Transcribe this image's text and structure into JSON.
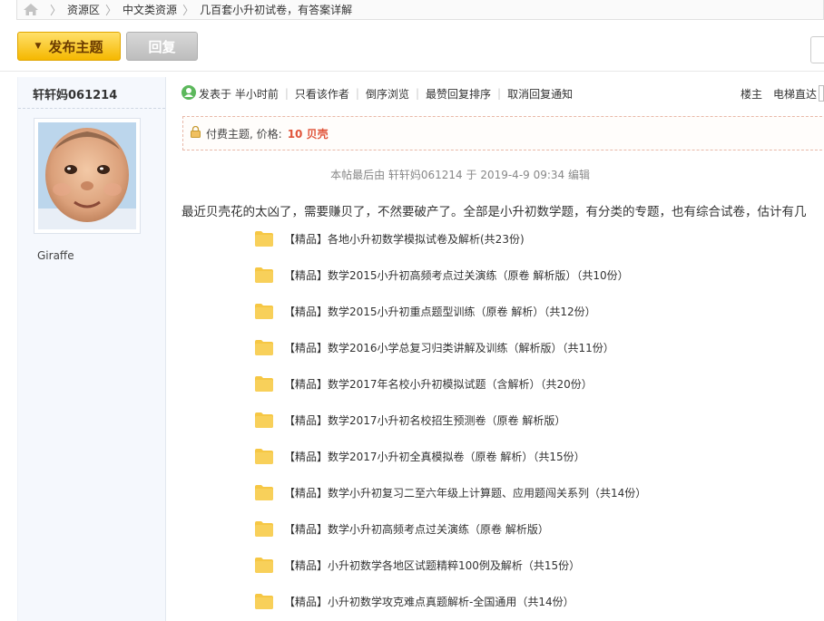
{
  "breadcrumb": {
    "items": [
      "资源区",
      "中文类资源",
      "几百套小升初试卷，有答案详解"
    ]
  },
  "actions": {
    "post_label": "发布主题",
    "reply_label": "回复"
  },
  "author": {
    "name": "轩轩妈061214",
    "group": "Giraffe"
  },
  "meta": {
    "posted": "发表于 半小时前",
    "links": [
      "只看该作者",
      "倒序浏览",
      "最赞回复排序",
      "取消回复通知"
    ],
    "floor": "楼主",
    "jump": "电梯直达"
  },
  "paid": {
    "label": "付费主题, 价格:",
    "price": "10 贝壳"
  },
  "edit_note": "本帖最后由 轩轩妈061214 于 2019-4-9 09:34 编辑",
  "intro": "最近贝壳花的太凶了，需要赚贝了，不然要破产了。全部是小升初数学题，有分类的专题，也有综合试卷，估计有几",
  "folders": [
    "【精品】各地小升初数学模拟试卷及解析(共23份)",
    "【精品】数学2015小升初高频考点过关演练（原卷 解析版）（共10份）",
    "【精品】数学2015小升初重点题型训练（原卷 解析）（共12份）",
    "【精品】数学2016小学总复习归类讲解及训练（解析版）（共11份）",
    "【精品】数学2017年名校小升初模拟试题（含解析）（共20份）",
    "【精品】数学2017小升初名校招生预测卷（原卷 解析版）",
    "【精品】数学2017小升初全真模拟卷（原卷 解析）（共15份）",
    "【精品】数学小升初复习二至六年级上计算题、应用题闯关系列（共14份）",
    "【精品】数学小升初高频考点过关演练（原卷 解析版）",
    "【精品】小升初数学各地区试题精粹100例及解析（共15份）",
    "【精品】小升初数学攻克难点真题解析-全国通用（共14份）"
  ],
  "colors": {
    "accent_yellow": "#f5b800",
    "price_red": "#e0543a",
    "folder_yellow": "#f6c744"
  }
}
